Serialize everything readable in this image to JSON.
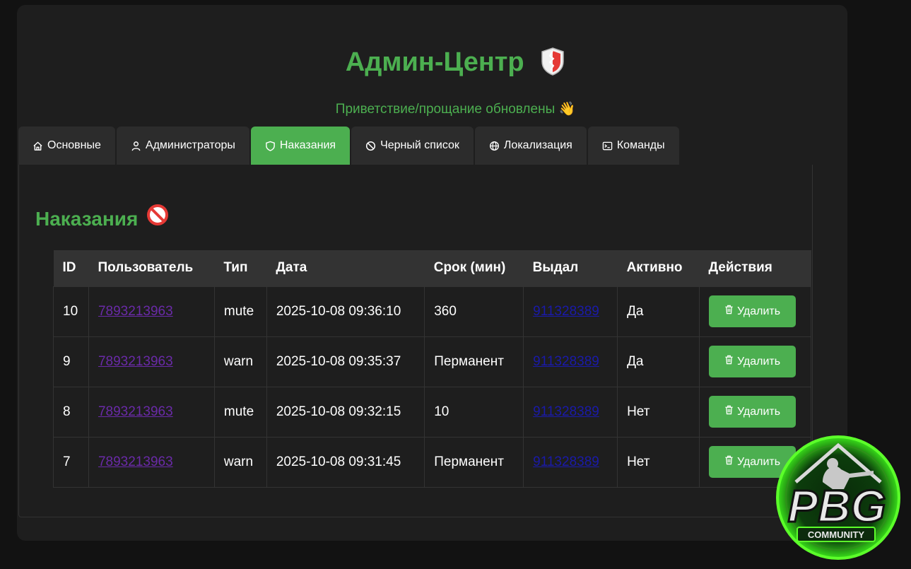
{
  "header": {
    "title": "Админ-Центр",
    "status": "Приветствие/прощание обновлены",
    "status_emoji": "👋"
  },
  "tabs": [
    {
      "label": "Основные",
      "icon": "home-icon",
      "active": false
    },
    {
      "label": "Администраторы",
      "icon": "user-icon",
      "active": false
    },
    {
      "label": "Наказания",
      "icon": "shield-icon",
      "active": true
    },
    {
      "label": "Черный список",
      "icon": "ban-icon",
      "active": false
    },
    {
      "label": "Локализация",
      "icon": "globe-icon",
      "active": false
    },
    {
      "label": "Команды",
      "icon": "terminal-icon",
      "active": false
    }
  ],
  "section": {
    "title": "Наказания",
    "icon": "prohibited-icon"
  },
  "table": {
    "headers": [
      "ID",
      "Пользователь",
      "Тип",
      "Дата",
      "Срок (мин)",
      "Выдал",
      "Активно",
      "Действия"
    ],
    "rows": [
      {
        "id": "10",
        "user": "7893213963",
        "type": "mute",
        "date": "2025-10-08 09:36:10",
        "term": "360",
        "issuer": "911328389",
        "active": "Да"
      },
      {
        "id": "9",
        "user": "7893213963",
        "type": "warn",
        "date": "2025-10-08 09:35:37",
        "term": "Перманент",
        "issuer": "911328389",
        "active": "Да"
      },
      {
        "id": "8",
        "user": "7893213963",
        "type": "mute",
        "date": "2025-10-08 09:32:15",
        "term": "10",
        "issuer": "911328389",
        "active": "Нет"
      },
      {
        "id": "7",
        "user": "7893213963",
        "type": "warn",
        "date": "2025-10-08 09:31:45",
        "term": "Перманент",
        "issuer": "911328389",
        "active": "Нет"
      }
    ],
    "delete_label": "Удалить"
  },
  "logo": {
    "main": "PBG",
    "sub": "COMMUNITY"
  },
  "colors": {
    "accent": "#4caf50",
    "background": "#121212",
    "panel": "#1e1e1e",
    "tab": "#2c2c2c"
  }
}
